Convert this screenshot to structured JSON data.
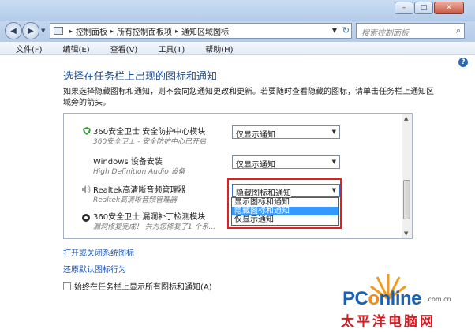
{
  "window": {
    "min": "–",
    "max": "□",
    "close": "✕"
  },
  "address": {
    "crumbs": [
      "控制面板",
      "所有控制面板项",
      "通知区域图标"
    ],
    "search_placeholder": "搜索控制面板"
  },
  "menu": [
    "文件(F)",
    "编辑(E)",
    "查看(V)",
    "工具(T)",
    "帮助(H)"
  ],
  "help_icon": "?",
  "page": {
    "title": "选择在任务栏上出现的图标和通知",
    "description": "如果选择隐藏图标和通知，则不会向您通知更改和更新。若要随时查看隐藏的图标，请单击任务栏上通知区域旁的箭头。"
  },
  "items": [
    {
      "name": "360安全卫士 安全防护中心模块",
      "sub": "360安全卫士 - 安全防护中心已开启",
      "value": "仅显示通知"
    },
    {
      "name": "Windows 设备安装",
      "sub": "High Definition Audio 设备",
      "value": "仅显示通知"
    },
    {
      "name": "Realtek高清晰音频管理器",
      "sub": "Realtek高清晰音频管理器",
      "value": "隐藏图标和通知"
    },
    {
      "name": "360安全卫士 漏洞补丁检测模块",
      "sub": "漏洞修复完成！ 共为您修复了1 个系...",
      "value": ""
    }
  ],
  "dropdown_options": [
    "显示图标和通知",
    "隐藏图标和通知",
    "仅显示通知"
  ],
  "dropdown_selected_index": 1,
  "links": {
    "toggle_system_icons": "打开或关闭系统图标",
    "restore_default": "还原默认图标行为"
  },
  "checkbox": {
    "label": "始终在任务栏上显示所有图标和通知(A)",
    "checked": false
  },
  "watermark": {
    "logo_a": "PC",
    "logo_b": "o",
    "logo_c": "nline",
    "domain": ".com.cn",
    "cn": "太平洋电脑网"
  },
  "colors": {
    "accent_link": "#1a55b5",
    "title": "#1b4c95",
    "highlight": "#e02020",
    "selection": "#3399ff"
  }
}
